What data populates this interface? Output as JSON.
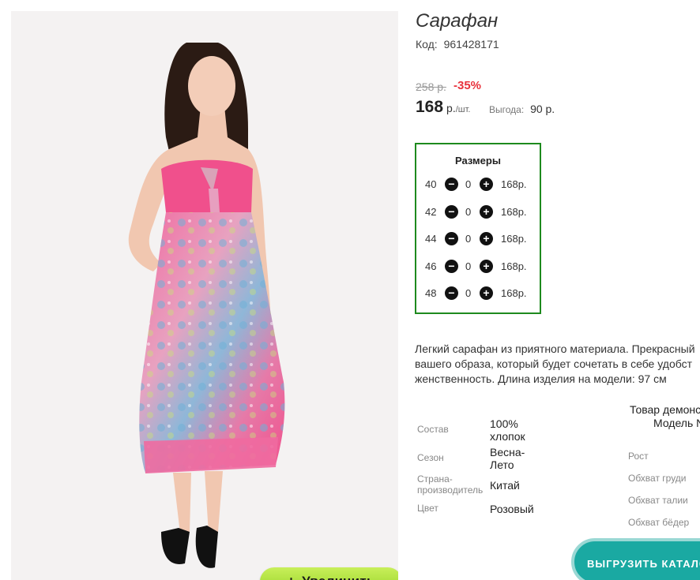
{
  "product": {
    "title": "Сарафан",
    "code_label": "Код:",
    "code": "961428171",
    "old_price": "258 р.",
    "discount": "-35%",
    "price": "168",
    "currency": "р.",
    "unit": "/шт.",
    "profit_label": "Выгода:",
    "profit": "90 р."
  },
  "zoom_button": {
    "plus": "+",
    "label": "Увеличить"
  },
  "sizes": {
    "title": "Размеры",
    "rows": [
      {
        "size": "40",
        "qty": "0",
        "price": "168р."
      },
      {
        "size": "42",
        "qty": "0",
        "price": "168р."
      },
      {
        "size": "44",
        "qty": "0",
        "price": "168р."
      },
      {
        "size": "46",
        "qty": "0",
        "price": "168р."
      },
      {
        "size": "48",
        "qty": "0",
        "price": "168р."
      }
    ]
  },
  "description": {
    "line1": "Легкий сарафан из приятного материала. Прекрасный",
    "line2": "вашего образа, который будет сочетать в себе удобст",
    "line3": "женственность. Длина изделия на модели: 97 см"
  },
  "specs": [
    {
      "label": "Состав",
      "value1": "100%",
      "value2": "хлопок"
    },
    {
      "label": "Сезон",
      "value1": "Весна-",
      "value2": "Лето"
    },
    {
      "label1": "Страна-",
      "label2": "производитель",
      "value1": "Китай"
    },
    {
      "label": "Цвет",
      "value1": "Розовый"
    }
  ],
  "demo": {
    "title": "Товар демонс",
    "subtitle": "Модель N",
    "measurements": [
      "Рост",
      "Обхват груди",
      "Обхват талии",
      "Обхват бёдер"
    ]
  },
  "export_button": {
    "label": "ВЫГРУЗИТЬ КАТАЛО"
  },
  "icons": {
    "minus": "minus-circle-icon",
    "plus": "plus-circle-icon"
  },
  "colors": {
    "accent_green": "#1e8a1e",
    "discount_red": "#e8323c",
    "zoom_button": "#a6dc2c",
    "export_button": "#1aa9a2",
    "dress_pink": "#f0508c"
  }
}
